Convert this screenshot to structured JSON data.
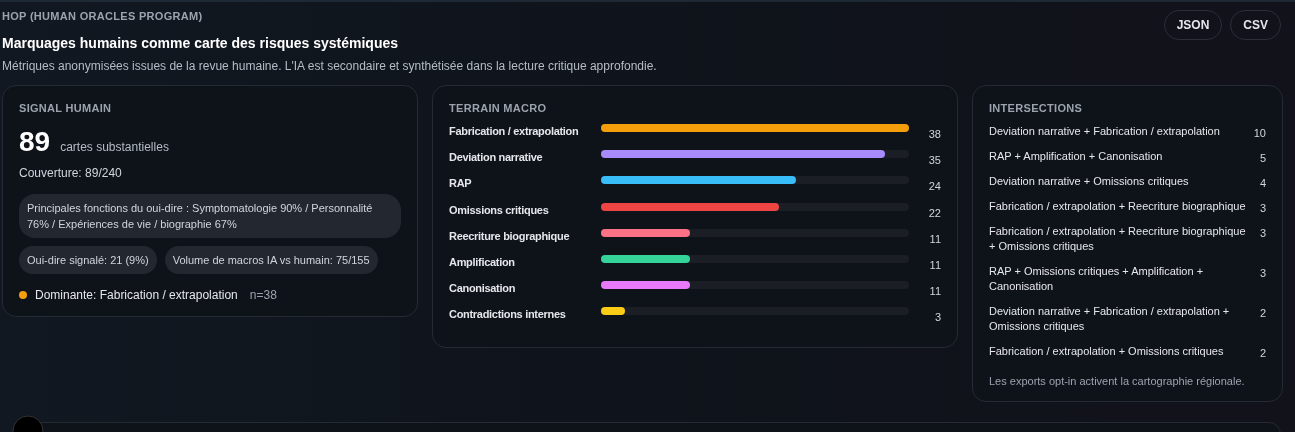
{
  "header": {
    "eyebrow": "HOP (HUMAN ORACLES PROGRAM)",
    "title": "Marquages humains comme carte des risques systémiques",
    "subtitle": "Métriques anonymisées issues de la revue humaine. L'IA est secondaire et synthétisée dans la lecture critique approfondie.",
    "buttons": [
      "JSON",
      "CSV"
    ]
  },
  "signal": {
    "title": "SIGNAL HUMAIN",
    "count": "89",
    "count_label": "cartes substantielles",
    "coverage": "Couverture: 89/240",
    "chips": [
      "Principales fonctions du oui-dire : Symptomatologie 90% / Personnalité 76% / Expériences de vie / biographie 67%",
      "Oui-dire signalé: 21 (9%)",
      "Volume de macros IA vs humain: 75/155"
    ],
    "dominant": {
      "label": "Dominante: Fabrication / extrapolation",
      "n": "n=38",
      "color": "#f59e0b"
    }
  },
  "terrain": {
    "title": "TERRAIN MACRO",
    "rows": [
      {
        "label": "Fabrication / extrapolation",
        "value": "38",
        "level": 1,
        "color": "#f59e0b"
      },
      {
        "label": "Deviation narrative",
        "value": "35",
        "level": 0.921,
        "color": "#a78bfa"
      },
      {
        "label": "RAP",
        "value": "24",
        "level": 0.632,
        "color": "#38bdf8"
      },
      {
        "label": "Omissions critiques",
        "value": "22",
        "level": 0.579,
        "color": "#ef4444"
      },
      {
        "label": "Reecriture biographique",
        "value": "11",
        "level": 0.289,
        "color": "#fb7185"
      },
      {
        "label": "Amplification",
        "value": "11",
        "level": 0.289,
        "color": "#34d399"
      },
      {
        "label": "Canonisation",
        "value": "11",
        "level": 0.289,
        "color": "#e879f9"
      },
      {
        "label": "Contradictions internes",
        "value": "3",
        "level": 0.079,
        "color": "#facc15"
      }
    ]
  },
  "intersections": {
    "title": "INTERSECTIONS",
    "rows": [
      {
        "label": "Deviation narrative + Fabrication / extrapolation",
        "value": "10"
      },
      {
        "label": "RAP + Amplification + Canonisation",
        "value": "5"
      },
      {
        "label": "Deviation narrative + Omissions critiques",
        "value": "4"
      },
      {
        "label": "Fabrication / extrapolation + Reecriture biographique",
        "value": "3"
      },
      {
        "label": "Fabrication / extrapolation + Reecriture biographique + Omissions critiques",
        "value": "3"
      },
      {
        "label": "RAP + Omissions critiques + Amplification + Canonisation",
        "value": "3"
      },
      {
        "label": "Deviation narrative + Fabrication / extrapolation + Omissions critiques",
        "value": "2"
      },
      {
        "label": "Fabrication / extrapolation + Omissions critiques",
        "value": "2"
      }
    ],
    "note": "Les exports opt-in activent la cartographie régionale."
  }
}
